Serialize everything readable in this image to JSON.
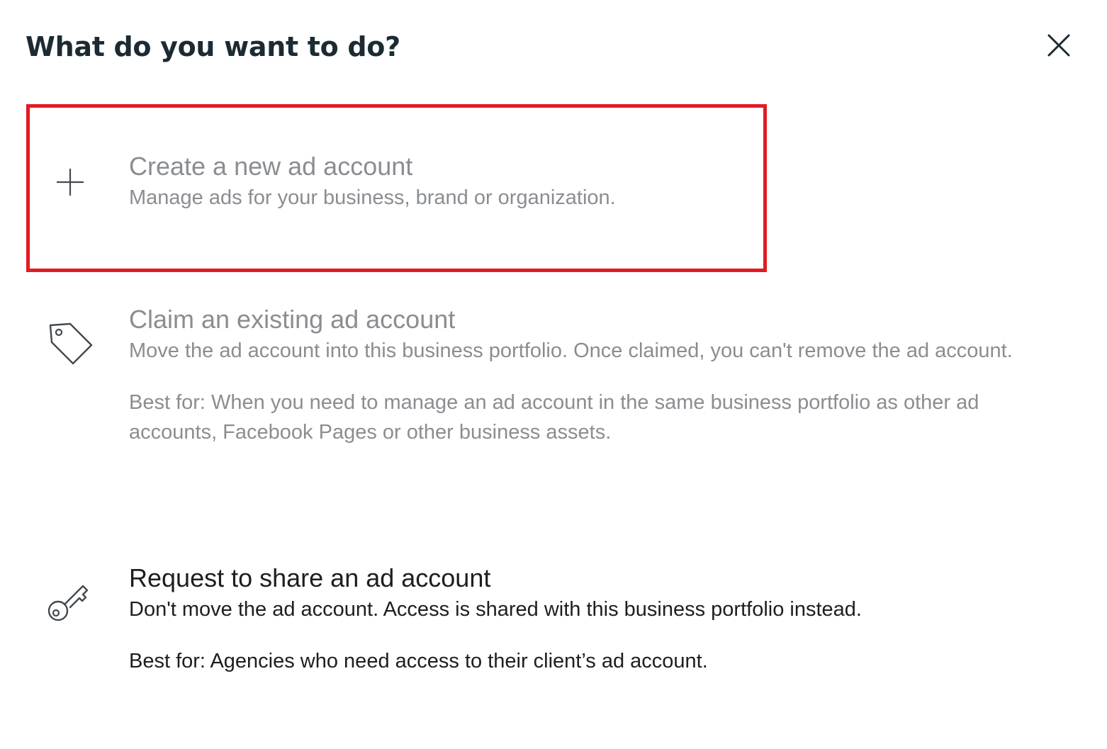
{
  "dialog": {
    "title": "What do you want to do?",
    "close_icon": "close-icon"
  },
  "options": [
    {
      "icon": "plus-icon",
      "title": "Create a new ad account",
      "description": "Manage ads for your business, brand or organization."
    },
    {
      "icon": "tag-icon",
      "title": "Claim an existing ad account",
      "description": "Move the ad account into this business portfolio. Once claimed, you can't remove the ad account.",
      "best_for": "Best for: When you need to manage an ad account in the same business portfolio as other ad accounts, Facebook Pages or other business assets."
    },
    {
      "icon": "key-icon",
      "title": "Request to share an ad account",
      "description": "Don't move the ad account. Access is shared with this business portfolio instead.",
      "best_for": "Best for: Agencies who need access to their client’s ad account."
    }
  ],
  "colors": {
    "highlight": "#e21b23",
    "muted_text": "#8a8d91",
    "primary_text": "#1c1e21"
  }
}
